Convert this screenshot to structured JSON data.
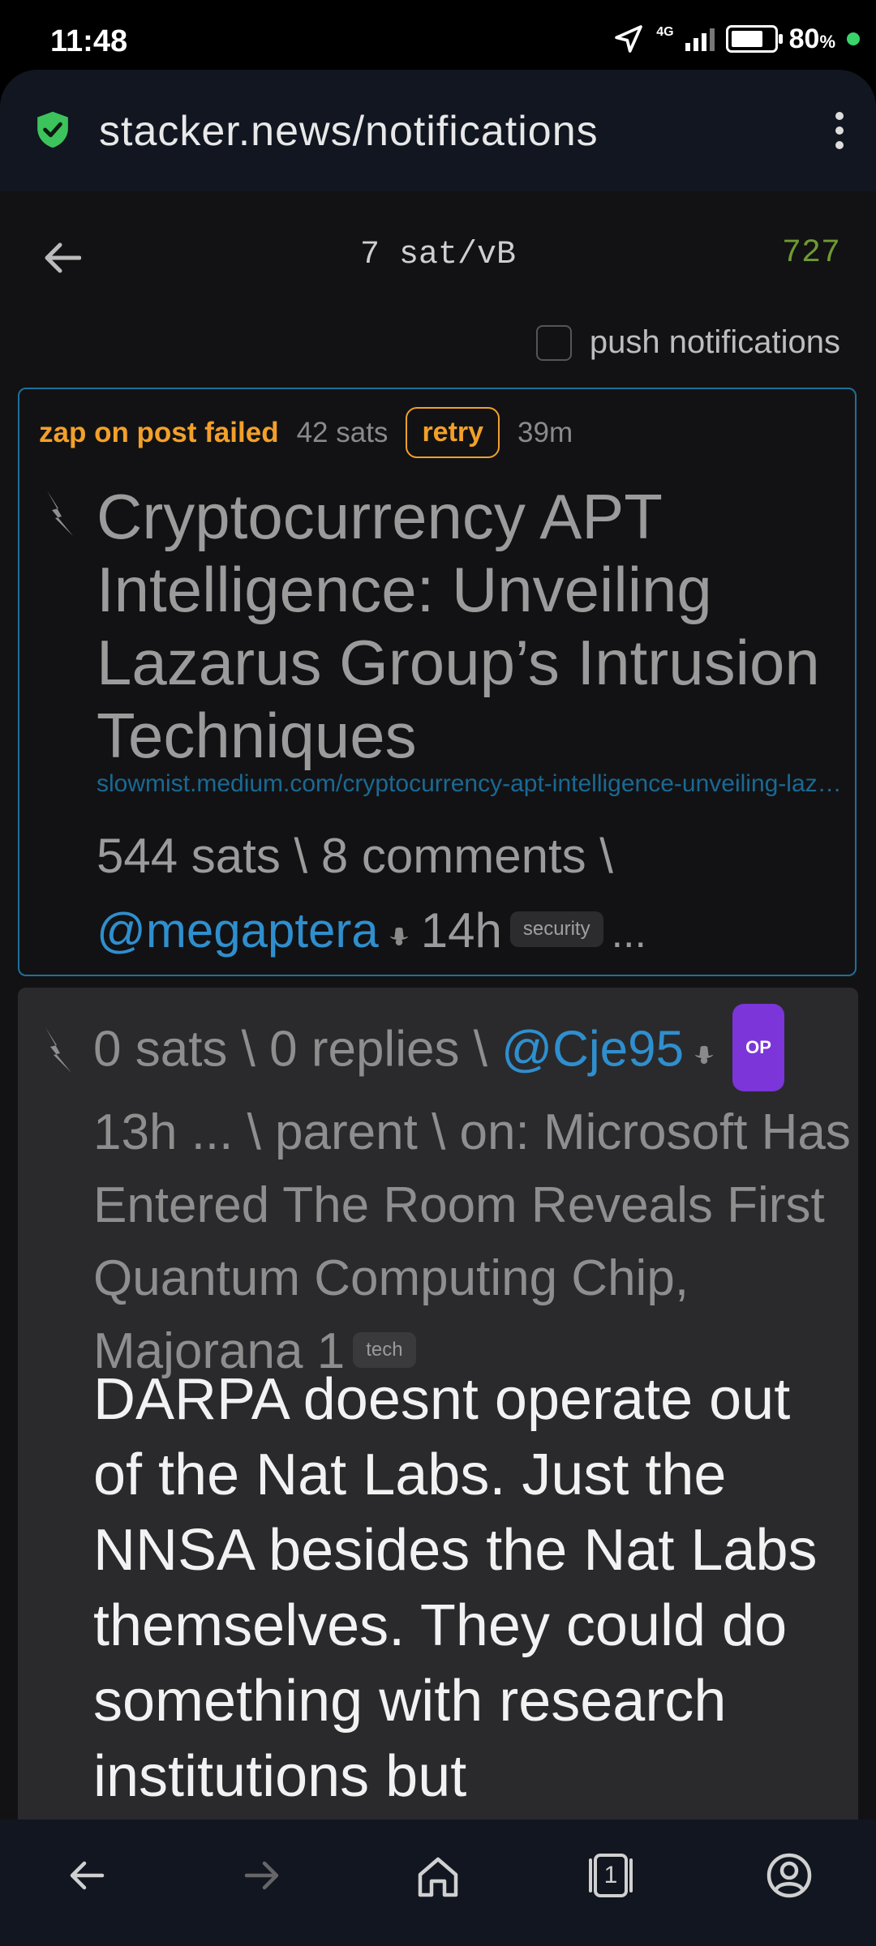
{
  "status": {
    "time": "11:48",
    "network": "4G",
    "battery": "80",
    "battery_unit": "%"
  },
  "browser": {
    "url": "stacker.news/notifications"
  },
  "topnav": {
    "fee_rate": "7 sat/vB",
    "block_height": "727"
  },
  "push": {
    "label": "push notifications"
  },
  "notif1": {
    "status": "zap on post failed",
    "amount": "42 sats",
    "retry_label": "retry",
    "age": "39m",
    "title": "Cryptocurrency APT Intelligence: Unveiling Lazarus Group’s Intrusion Techniques",
    "link": "slowmist.medium.com/cryptocurrency-apt-intelligence-unveiling-lazarus-group-intrusion-techniques",
    "sats": "544 sats",
    "sep1": " \\ ",
    "comments": "8 comments",
    "sep2": " \\ ",
    "user": "@megaptera",
    "time": "14h",
    "sub": "security",
    "more": "..."
  },
  "notif2": {
    "sats": "0 sats",
    "sep1": " \\ ",
    "replies": "0 replies",
    "sep2": " \\ ",
    "user": "@Cje95",
    "op": "OP",
    "time": "13h",
    "more": "...",
    "parent": " \\ parent \\ ",
    "on": "on: Microsoft Has Entered The Room Reveals First Quantum Computing Chip, Majorana 1",
    "sub": "tech",
    "body": "DARPA doesnt operate out of the Nat Labs. Just the NNSA besides the Nat Labs themselves. They could do something with research institutions but"
  },
  "navbar": {
    "tab_count": "1"
  }
}
